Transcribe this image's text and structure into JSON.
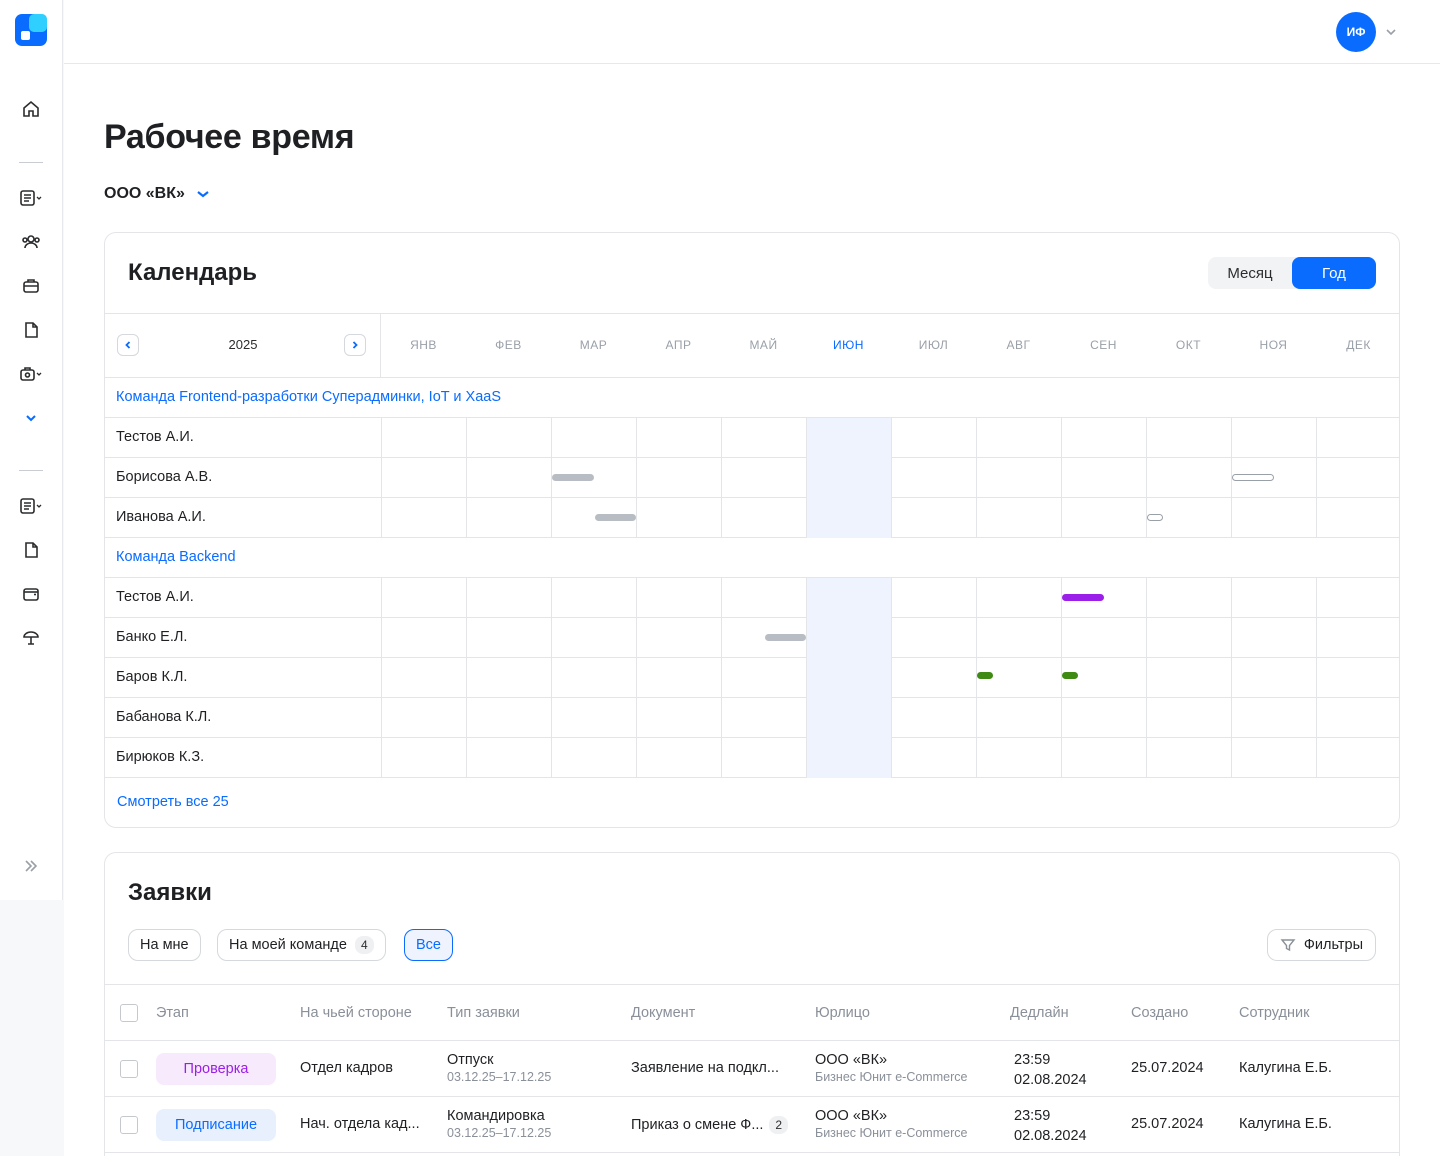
{
  "user": {
    "initials": "ИФ"
  },
  "page": {
    "title": "Рабочее время",
    "org": "ООО «ВК»"
  },
  "calendar": {
    "title": "Календарь",
    "view_month": "Месяц",
    "view_year": "Год",
    "year": "2025",
    "months": [
      "ЯНВ",
      "ФЕВ",
      "МАР",
      "АПР",
      "МАЙ",
      "ИЮН",
      "ИЮЛ",
      "АВГ",
      "СЕН",
      "ОКТ",
      "НОЯ",
      "ДЕК"
    ],
    "current_month_index": 5,
    "rows": [
      {
        "kind": "team",
        "label": "Команда Frontend-разработки Суперадминки, IoT и XaaS"
      },
      {
        "kind": "person",
        "name": "Тестов А.И.",
        "bars": []
      },
      {
        "kind": "person",
        "name": "Борисова А.В.",
        "bars": [
          {
            "start": 2.0,
            "end": 2.5,
            "style": "gray"
          },
          {
            "start": 10.0,
            "end": 10.5,
            "style": "outline"
          }
        ]
      },
      {
        "kind": "person",
        "name": "Иванова А.И.",
        "bars": [
          {
            "start": 2.5,
            "end": 3.0,
            "style": "gray"
          },
          {
            "start": 9.0,
            "end": 9.2,
            "style": "outline"
          }
        ]
      },
      {
        "kind": "team",
        "label": "Команда Backend"
      },
      {
        "kind": "person",
        "name": "Тестов А.И.",
        "bars": [
          {
            "start": 8.0,
            "end": 8.5,
            "style": "purple"
          }
        ]
      },
      {
        "kind": "person",
        "name": "Банко Е.Л.",
        "bars": [
          {
            "start": 4.5,
            "end": 5.0,
            "style": "gray"
          }
        ]
      },
      {
        "kind": "person",
        "name": "Баров К.Л.",
        "bars": [
          {
            "start": 7.0,
            "end": 7.2,
            "style": "green"
          },
          {
            "start": 8.0,
            "end": 8.2,
            "style": "green"
          }
        ]
      },
      {
        "kind": "person",
        "name": "Бабанова К.Л.",
        "bars": []
      },
      {
        "kind": "person",
        "name": "Бирюков К.З.",
        "bars": []
      }
    ],
    "see_all": "Смотреть все 25"
  },
  "colors": {
    "gray": "#b8bdc4",
    "purple": "#9b1fe8",
    "green": "#3f8a12",
    "outline": "#9aa0a8"
  },
  "requests": {
    "title": "Заявки",
    "chips": [
      {
        "label": "На мне"
      },
      {
        "label": "На моей команде",
        "count": "4"
      },
      {
        "label": "Все",
        "active": true
      }
    ],
    "filters": "Фильтры",
    "columns": [
      "Этап",
      "На чьей стороне",
      "Тип заявки",
      "Документ",
      "Юрлицо",
      "Дедлайн",
      "Создано",
      "Сотрудник"
    ],
    "rows": [
      {
        "stage": "Проверка",
        "stage_bg": "#f7eafd",
        "stage_fg": "#9b1fe8",
        "side": "Отдел кадров",
        "type": "Отпуск",
        "type_dates": "03.12.25–17.12.25",
        "document": "Заявление на подкл...",
        "doc_count": "",
        "entity": "ООО «ВК»",
        "entity_sub": "Бизнес Юнит e-Commerce",
        "deadline_time": "23:59",
        "deadline_date": "02.08.2024",
        "created": "25.07.2024",
        "employee": "Калугина Е.Б."
      },
      {
        "stage": "Подписание",
        "stage_bg": "#e8f0fe",
        "stage_fg": "#0a6cff",
        "side": "Нач. отдела кад...",
        "type": "Командировка",
        "type_dates": "03.12.25–17.12.25",
        "document": "Приказ о смене Ф...",
        "doc_count": "2",
        "entity": "ООО «ВК»",
        "entity_sub": "Бизнес Юнит e-Commerce",
        "deadline_time": "23:59",
        "deadline_date": "02.08.2024",
        "created": "25.07.2024",
        "employee": "Калугина Е.Б."
      }
    ]
  }
}
